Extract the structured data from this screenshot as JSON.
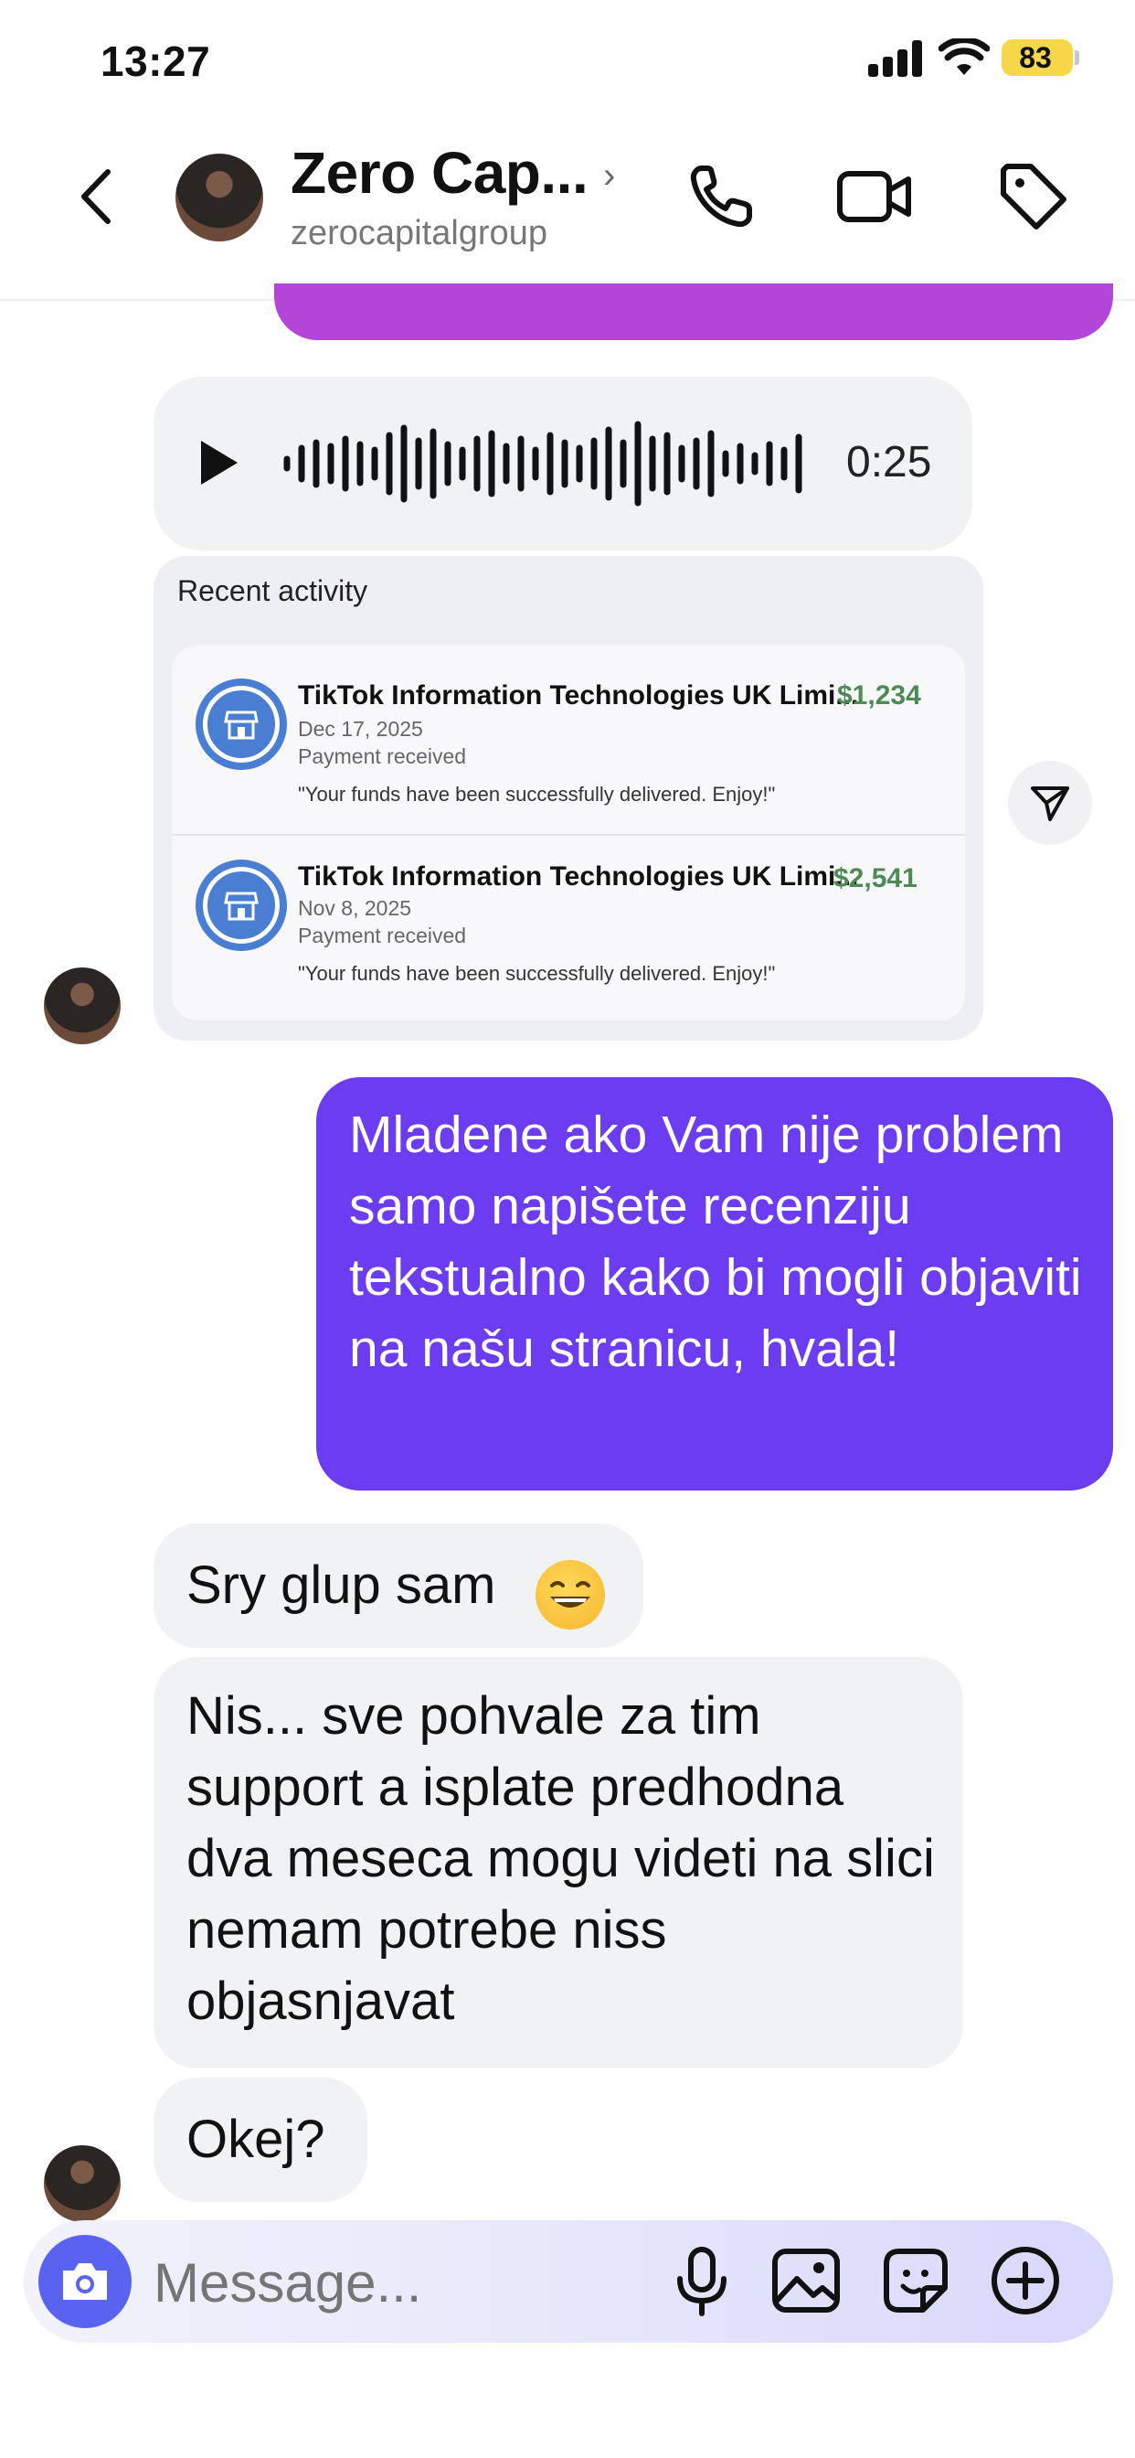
{
  "status_bar": {
    "time": "13:27",
    "battery": "83"
  },
  "header": {
    "title": "Zero Cap...",
    "subtitle": "zerocapitalgroup",
    "chevron": "›",
    "icons": [
      "back-chevron-icon",
      "phone-icon",
      "video-camera-icon",
      "tag-icon"
    ]
  },
  "messages": {
    "voice": {
      "duration": "0:25"
    },
    "activity_card": {
      "title": "Recent activity",
      "items": [
        {
          "merchant": "TikTok Information Technologies UK Limi...",
          "amount": "$1,234",
          "date": "Dec 17, 2025",
          "status": "Payment received",
          "note": "\"Your funds have been successfully delivered. Enjoy!\""
        },
        {
          "merchant": "TikTok Information Technologies UK Limi...",
          "amount": "$2,541",
          "date": "Nov 8, 2025",
          "status": "Payment received",
          "note": "\"Your funds have been successfully delivered. Enjoy!\""
        }
      ]
    },
    "outgoing_1": "Mladene ako Vam nije problem samo napišete recenziju tekstualno kako bi mogli objaviti na našu stranicu, hvala!",
    "incoming_1": "Sry glup sam",
    "incoming_2": "Nis... sve pohvale za tim support a isplate predhodna dva meseca mogu videti na slici nemam potrebe niss objasnjavat",
    "incoming_3": "Okej?"
  },
  "composer": {
    "placeholder": "Message...",
    "icons": [
      "camera-icon",
      "microphone-icon",
      "image-icon",
      "sticker-icon",
      "plus-icon"
    ]
  },
  "colors": {
    "outgoing_bubble": "#6b3cf0",
    "incoming_bubble": "#f1f2f4",
    "amount_green": "#4d8a54",
    "battery": "#f6d74a"
  }
}
